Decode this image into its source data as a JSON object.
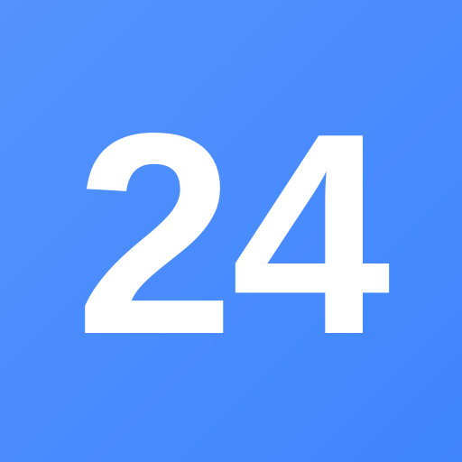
{
  "icon": {
    "text": "24",
    "colors": {
      "background_start": "#5493fd",
      "background_end": "#3f85fe",
      "foreground": "#ffffff"
    }
  }
}
